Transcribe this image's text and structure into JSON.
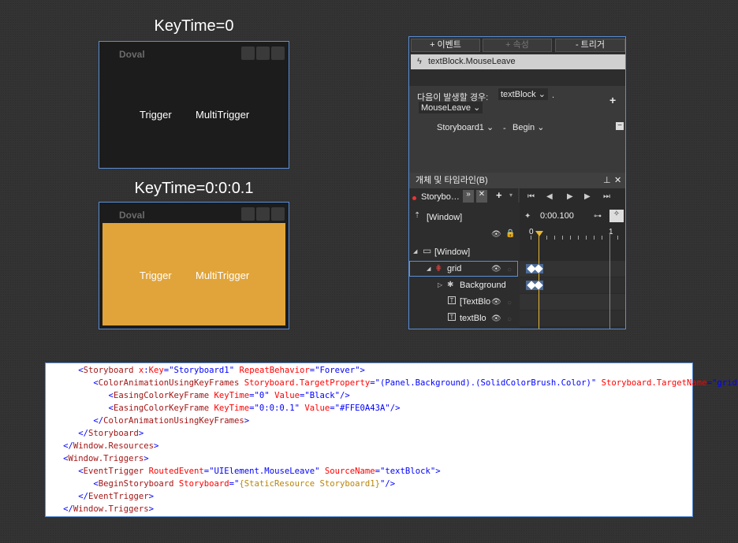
{
  "top_window": {
    "title_label": "KeyTime=0",
    "app_name": "Doval",
    "btn1": "Trigger",
    "btn2": "MultiTrigger"
  },
  "bottom_window": {
    "title_label": "KeyTime=0:0:0.1",
    "app_name": "Doval",
    "btn1": "Trigger",
    "btn2": "MultiTrigger",
    "background_color": "#E0A43A"
  },
  "blend_panel": {
    "tabs": [
      "+ 이벤트",
      "+ 속성",
      "- 트리거"
    ],
    "event_item": "textBlock.MouseLeave",
    "condition_label": "다음이 발생할 경우:",
    "source_value": "textBlock",
    "dot": ".",
    "event_value": "MouseLeave",
    "storyboard_value": "Storyboard1",
    "action_dash": "-",
    "action_value": "Begin",
    "objects_header": "개체 및 타임라인(B)",
    "storyboard_tab": "Storybo…",
    "time_value": "0:00.100",
    "ruler_start": "0",
    "ruler_end": "1",
    "tree": [
      {
        "label": "[Window]"
      },
      {
        "label": "[Window]"
      },
      {
        "label": "grid"
      },
      {
        "label": "Background"
      },
      {
        "label": "[TextBlo"
      },
      {
        "label": "textBlo"
      }
    ]
  },
  "code": {
    "lines": [
      {
        "indent": "      ",
        "parts": [
          [
            "br",
            "<"
          ],
          [
            "el",
            "Storyboard"
          ],
          [
            "an",
            " x"
          ],
          [
            "br",
            ":"
          ],
          [
            "an",
            "Key"
          ],
          [
            "br",
            "=\""
          ],
          [
            "av",
            "Storyboard1"
          ],
          [
            "br",
            "\""
          ],
          [
            "an",
            " RepeatBehavior"
          ],
          [
            "br",
            "=\""
          ],
          [
            "av",
            "Forever"
          ],
          [
            "br",
            "\">"
          ]
        ]
      },
      {
        "indent": "         ",
        "parts": [
          [
            "br",
            "<"
          ],
          [
            "el",
            "ColorAnimationUsingKeyFrames"
          ],
          [
            "an",
            " Storyboard.TargetProperty"
          ],
          [
            "br",
            "=\""
          ],
          [
            "av",
            "(Panel.Background).(SolidColorBrush.Color)"
          ],
          [
            "br",
            "\""
          ],
          [
            "an",
            " Storyboard.TargetName"
          ],
          [
            "br",
            "=\""
          ],
          [
            "av",
            "grid"
          ],
          [
            "br",
            "\">"
          ]
        ]
      },
      {
        "indent": "            ",
        "parts": [
          [
            "br",
            "<"
          ],
          [
            "el",
            "EasingColorKeyFrame"
          ],
          [
            "an",
            " KeyTime"
          ],
          [
            "br",
            "=\""
          ],
          [
            "av",
            "0"
          ],
          [
            "br",
            "\""
          ],
          [
            "an",
            " Value"
          ],
          [
            "br",
            "=\""
          ],
          [
            "av",
            "Black"
          ],
          [
            "br",
            "\"/>"
          ]
        ]
      },
      {
        "indent": "            ",
        "parts": [
          [
            "br",
            "<"
          ],
          [
            "el",
            "EasingColorKeyFrame"
          ],
          [
            "an",
            " KeyTime"
          ],
          [
            "br",
            "=\""
          ],
          [
            "av",
            "0:0:0.1"
          ],
          [
            "br",
            "\""
          ],
          [
            "an",
            " Value"
          ],
          [
            "br",
            "=\""
          ],
          [
            "av",
            "#FFE0A43A"
          ],
          [
            "br",
            "\"/>"
          ]
        ]
      },
      {
        "indent": "         ",
        "parts": [
          [
            "br",
            "</"
          ],
          [
            "el",
            "ColorAnimationUsingKeyFrames"
          ],
          [
            "br",
            ">"
          ]
        ]
      },
      {
        "indent": "      ",
        "parts": [
          [
            "br",
            "</"
          ],
          [
            "el",
            "Storyboard"
          ],
          [
            "br",
            ">"
          ]
        ]
      },
      {
        "indent": "   ",
        "parts": [
          [
            "br",
            "</"
          ],
          [
            "el",
            "Window.Resources"
          ],
          [
            "br",
            ">"
          ]
        ]
      },
      {
        "indent": "   ",
        "parts": [
          [
            "br",
            "<"
          ],
          [
            "el",
            "Window.Triggers"
          ],
          [
            "br",
            ">"
          ]
        ]
      },
      {
        "indent": "      ",
        "parts": [
          [
            "br",
            "<"
          ],
          [
            "el",
            "EventTrigger"
          ],
          [
            "an",
            " RoutedEvent"
          ],
          [
            "br",
            "=\""
          ],
          [
            "av",
            "UIElement.MouseLeave"
          ],
          [
            "br",
            "\""
          ],
          [
            "an",
            " SourceName"
          ],
          [
            "br",
            "=\""
          ],
          [
            "av",
            "textBlock"
          ],
          [
            "br",
            "\">"
          ]
        ]
      },
      {
        "indent": "         ",
        "parts": [
          [
            "br",
            "<"
          ],
          [
            "el",
            "BeginStoryboard"
          ],
          [
            "an",
            " Storyboard"
          ],
          [
            "br",
            "=\""
          ],
          [
            "ext",
            "{StaticResource Storyboard1}"
          ],
          [
            "br",
            "\"/>"
          ]
        ]
      },
      {
        "indent": "      ",
        "parts": [
          [
            "br",
            "</"
          ],
          [
            "el",
            "EventTrigger"
          ],
          [
            "br",
            ">"
          ]
        ]
      },
      {
        "indent": "   ",
        "parts": [
          [
            "br",
            "</"
          ],
          [
            "el",
            "Window.Triggers"
          ],
          [
            "br",
            ">"
          ]
        ]
      }
    ]
  }
}
